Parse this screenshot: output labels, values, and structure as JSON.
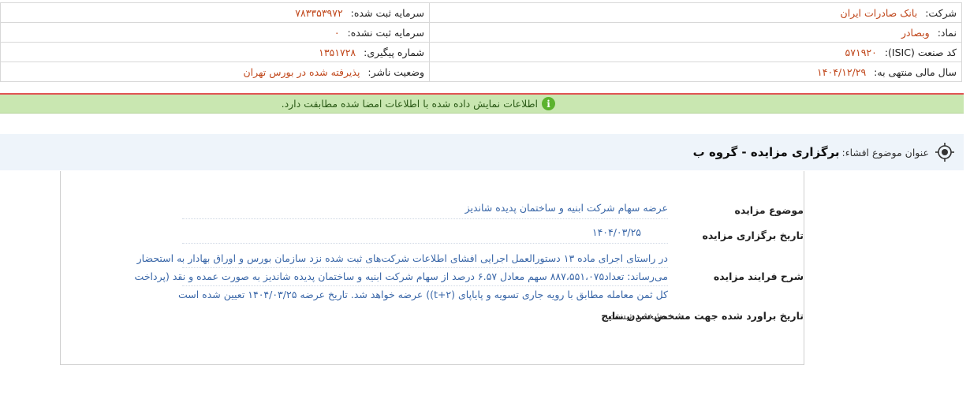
{
  "company_info": {
    "company_label": "شرکت:",
    "company_value": "بانک صادرات ایران",
    "registered_capital_label": "سرمایه ثبت شده:",
    "registered_capital_value": "۷۸۳۳۵۳۹۷۲",
    "symbol_label": "نماد:",
    "symbol_value": "وبصادر",
    "unregistered_capital_label": "سرمایه ثبت نشده:",
    "unregistered_capital_value": "۰",
    "isic_label": "کد صنعت (ISIC):",
    "isic_value": "۵۷۱۹۲۰",
    "tracking_label": "شماره پیگیری:",
    "tracking_value": "۱۳۵۱۷۲۸",
    "fiscal_year_label": "سال مالی منتهی به:",
    "fiscal_year_value": "۱۴۰۴/۱۲/۲۹",
    "publisher_status_label": "وضعیت ناشر:",
    "publisher_status_value": "پذیرفته شده در بورس تهران"
  },
  "alert": {
    "icon": "info-icon",
    "text": "اطلاعات نمایش داده شده با اطلاعات امضا شده مطابقت دارد."
  },
  "subject": {
    "icon": "target-icon",
    "label": "عنوان موضوع افشاء:",
    "title": "برگزاری مزایده - گروه ب"
  },
  "details": {
    "topic_label": "موضوع مزایده",
    "topic_value": "عرضه سهام شرکت ابنیه و ساختمان پدیده شاندیز",
    "date_label": "تاریخ برگزاری مزایده",
    "date_value": "۱۴۰۴/۰۳/۲۵",
    "process_label": "شرح فرایند مزایده",
    "process_line1": "در راستای اجرای ماده ۱۳ دستورالعمل اجرایی افشای اطلاعات شرکت‌های ثبت شده نزد سازمان بورس و اوراق بهادار به استحضار",
    "process_line2": "می‌رساند: تعداد۸۸۷،۵۵۱،۰۷۵ سهم معادل ۶.۵۷ درصد از سهام شرکت ابنیه و ساختمان پدیده شاندیز به صورت عمده و نقد (پرداخت",
    "process_line3": "کل ثمن معامله مطابق با رویه جاری تسویه و پایاپای (t+۲)) عرضه خواهد شد. تاریخ عرضه ۱۴۰۴/۰۳/۲۵ تعیین شده است",
    "estimate_label": "تاریخ براورد شده جهت مشخص شدن نتایج",
    "estimate_value": "مشخص نیست"
  },
  "colors": {
    "value_orange": "#c0471b",
    "alert_green": "#c9e7b1",
    "alert_border_red": "#e05555",
    "link_blue": "#3a67a8"
  }
}
